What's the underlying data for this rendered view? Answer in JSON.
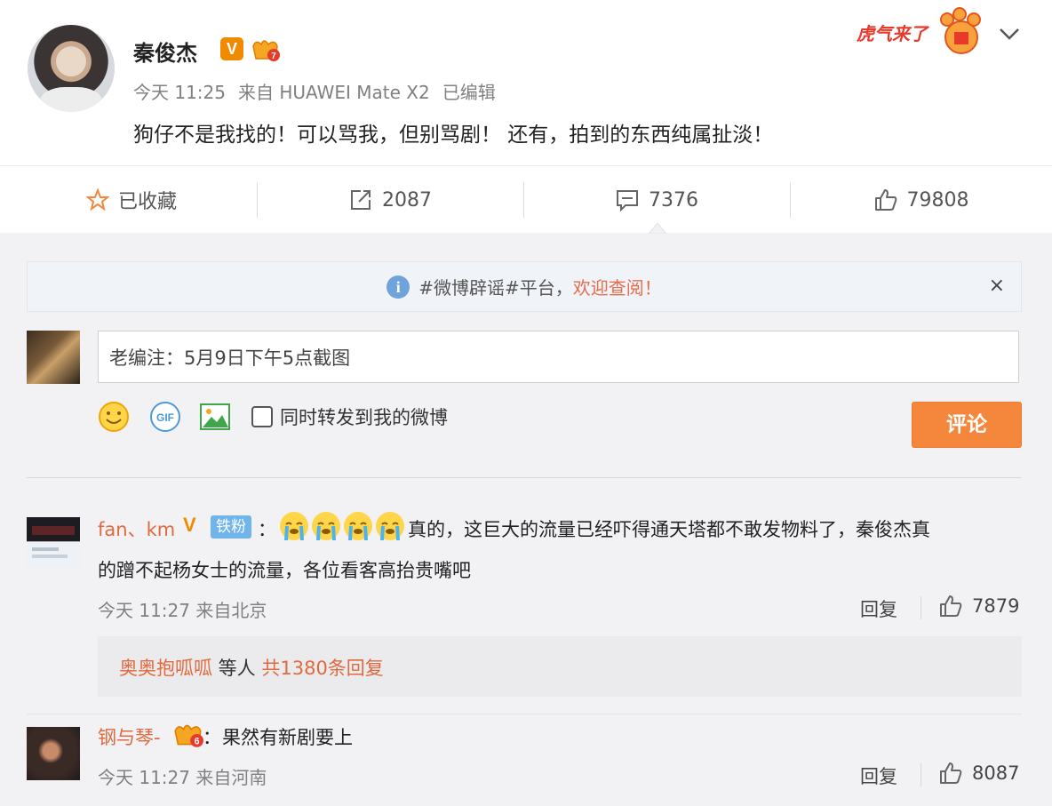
{
  "post": {
    "author": "秦俊杰",
    "verified_mark": "V",
    "time": "今天 11:25",
    "source": "来自 HUAWEI Mate X2",
    "edited": "已编辑",
    "text": "狗仔不是我找的！可以骂我，但别骂剧！ 还有，拍到的东西纯属扯淡！",
    "sticker_text": "虎气来了"
  },
  "actions": {
    "favorite": "已收藏",
    "reposts": "2087",
    "comments": "7376",
    "likes": "79808"
  },
  "notice": {
    "prefix": "#微博辟谣#平台，",
    "highlight": "欢迎查阅！",
    "close": "×"
  },
  "composer": {
    "input_value": "老编注：5月9日下午5点截图",
    "sync_label": "同时转发到我的微博",
    "submit_label": "评论"
  },
  "comments": [
    {
      "user": "fan、km",
      "verified_mark": "V",
      "fan_badge": "铁粉",
      "colon": "：",
      "text_line1": "真的，这巨大的流量已经吓得通天塔都不敢发物料了，秦俊杰真",
      "text_line2": "的蹭不起杨女士的流量，各位看客高抬贵嘴吧",
      "meta": "今天 11:27 来自北京",
      "reply_label": "回复",
      "likes": "7879",
      "replies": {
        "user": "奥奥抱呱呱",
        "middle": " 等人 ",
        "count": "共1380条回复"
      }
    },
    {
      "user": "钢与琴-",
      "colon": "：",
      "text": "果然有新剧要上",
      "meta": "今天 11:27 来自河南",
      "reply_label": "回复",
      "likes": "8087"
    }
  ],
  "colors": {
    "accent_orange": "#f5873c",
    "name_orange": "#e06a3d",
    "info_blue": "#6ea3dc"
  }
}
